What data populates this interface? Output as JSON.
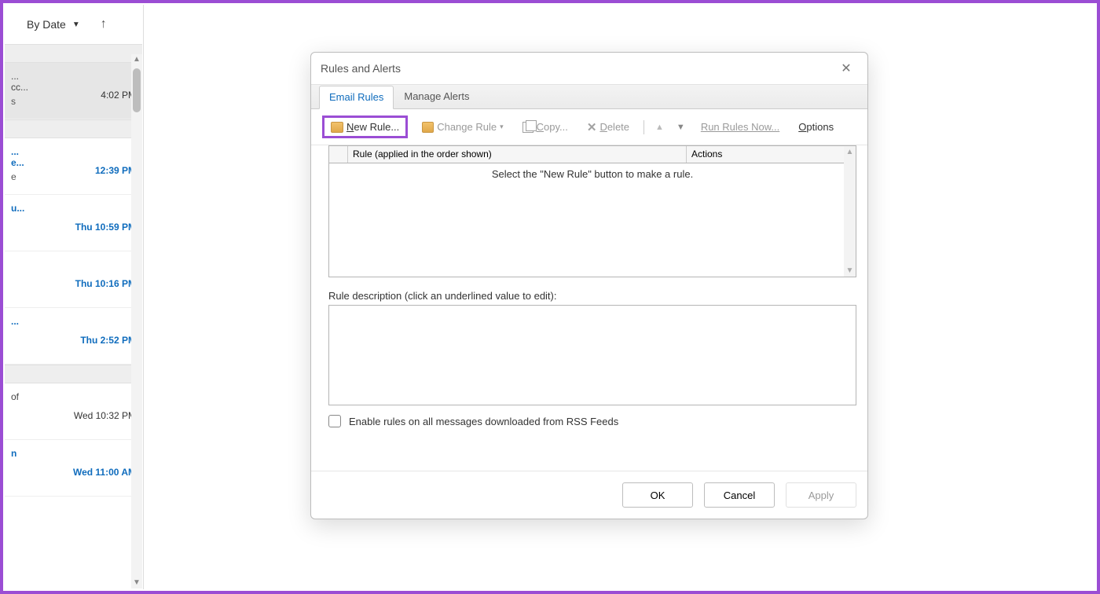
{
  "sort": {
    "label": "By Date"
  },
  "mail_items": [
    {
      "frag": "...",
      "time": "4:02 PM",
      "sub": "cc...",
      "unread": false,
      "selected": true,
      "extra": "s"
    },
    {
      "frag": "...",
      "time": "12:39 PM",
      "sub": "e...",
      "unread": true,
      "selected": false,
      "extra": "e"
    },
    {
      "frag": "u...",
      "time": "Thu 10:59 PM",
      "sub": "",
      "unread": true,
      "selected": false,
      "extra": ""
    },
    {
      "frag": "",
      "time": "Thu 10:16 PM",
      "sub": "",
      "unread": true,
      "selected": false,
      "extra": ""
    },
    {
      "frag": "...",
      "time": "Thu 2:52 PM",
      "sub": "",
      "unread": true,
      "selected": false,
      "extra": ""
    },
    {
      "frag": "",
      "time": "Wed 10:32 PM",
      "sub": "of",
      "unread": false,
      "selected": false,
      "extra": ""
    },
    {
      "frag": "",
      "time": "Wed 11:00 AM",
      "sub": "n",
      "unread": true,
      "selected": false,
      "extra": ""
    }
  ],
  "dialog": {
    "title": "Rules and Alerts",
    "tabs": {
      "email_rules": "Email Rules",
      "manage_alerts": "Manage Alerts"
    },
    "toolbar": {
      "new_rule": "New Rule...",
      "change_rule": "Change Rule",
      "copy": "Copy...",
      "delete": "Delete",
      "run_rules": "Run Rules Now...",
      "options": "Options"
    },
    "rules_header_rule": "Rule (applied in the order shown)",
    "rules_header_actions": "Actions",
    "empty_msg": "Select the \"New Rule\" button to make a rule.",
    "desc_label": "Rule description (click an underlined value to edit):",
    "rss_label": "Enable rules on all messages downloaded from RSS Feeds",
    "buttons": {
      "ok": "OK",
      "cancel": "Cancel",
      "apply": "Apply"
    }
  }
}
